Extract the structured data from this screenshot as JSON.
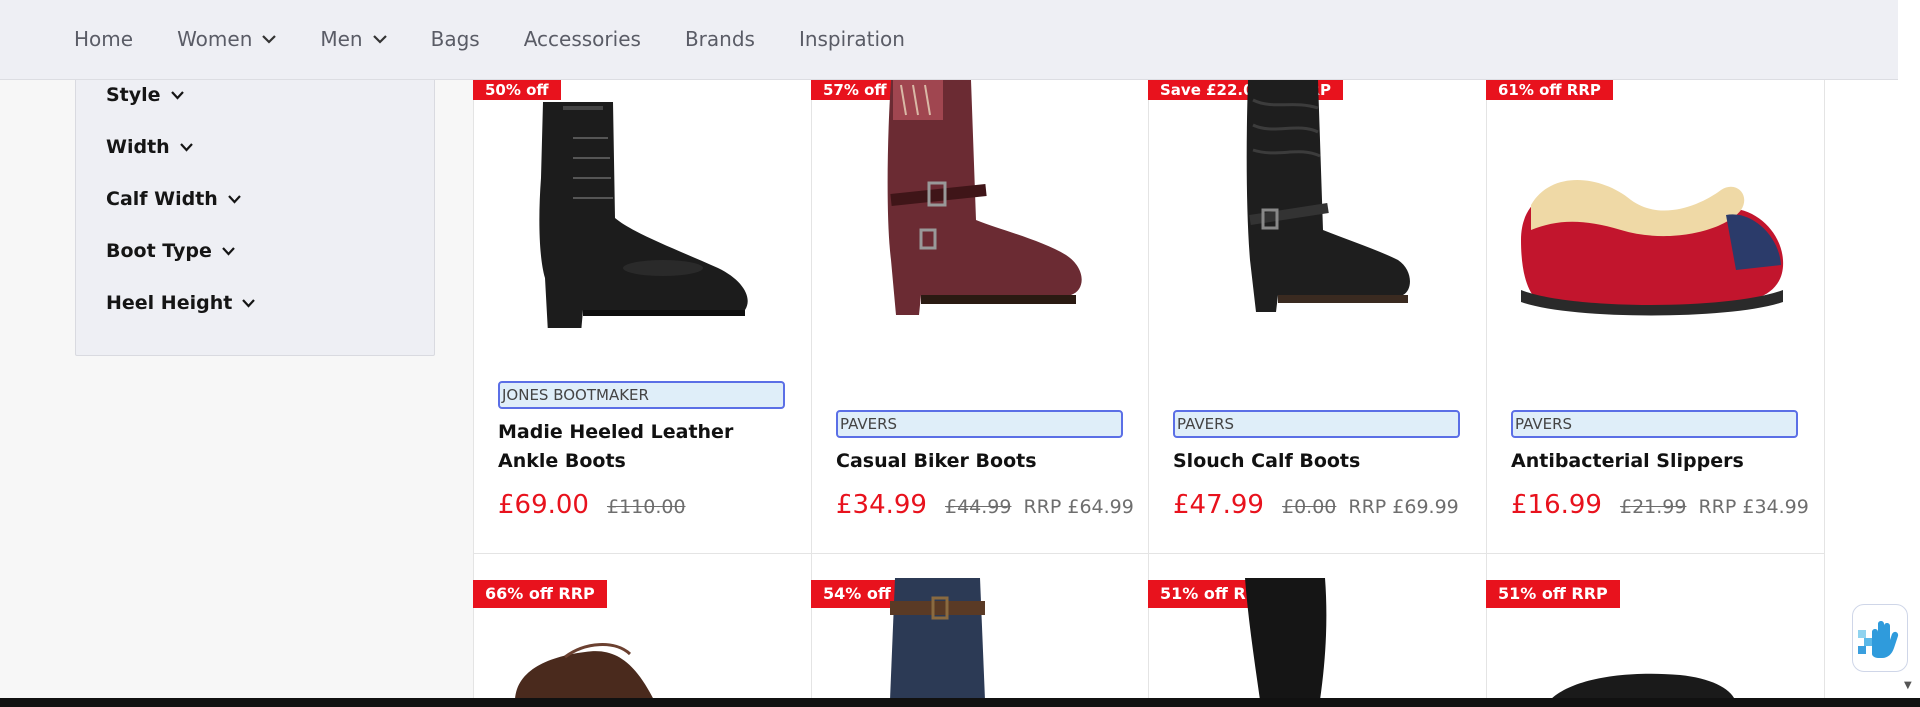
{
  "nav": {
    "items": [
      {
        "label": "Home",
        "dropdown": false
      },
      {
        "label": "Women",
        "dropdown": true
      },
      {
        "label": "Men",
        "dropdown": true
      },
      {
        "label": "Bags",
        "dropdown": false
      },
      {
        "label": "Accessories",
        "dropdown": false
      },
      {
        "label": "Brands",
        "dropdown": false
      },
      {
        "label": "Inspiration",
        "dropdown": false
      }
    ]
  },
  "filters": [
    "Style",
    "Width",
    "Calf Width",
    "Boot Type",
    "Heel Height"
  ],
  "products": [
    {
      "badge": "50% off",
      "brand": "JONES BOOTMAKER",
      "name": "Madie Heeled Leather Ankle Boots",
      "price": "£69.00",
      "was": "£110.00",
      "rrp": "",
      "icon": "black-lace-up-boot-icon"
    },
    {
      "badge": "57% off RRP",
      "brand": "PAVERS",
      "name": "Casual Biker Boots",
      "price": "£34.99",
      "was": "£44.99",
      "rrp": "RRP £64.99",
      "icon": "burgundy-biker-boot-icon"
    },
    {
      "badge": "Save £22.00 off RRP",
      "brand": "PAVERS",
      "name": "Slouch Calf Boots",
      "price": "£47.99",
      "was": "£0.00",
      "rrp": "RRP £69.99",
      "icon": "black-slouch-boot-icon"
    },
    {
      "badge": "61% off RRP",
      "brand": "PAVERS",
      "name": "Antibacterial Slippers",
      "price": "£16.99",
      "was": "£21.99",
      "rrp": "RRP £34.99",
      "icon": "red-slipper-icon"
    }
  ],
  "second_row_badges": [
    "66% off RRP",
    "54% off RRP",
    "51% off RRP",
    "51% off RRP"
  ],
  "colors": {
    "accent": "#e8121d",
    "nav_bg": "#eeeff4",
    "brand_border": "#5b6fe6"
  }
}
